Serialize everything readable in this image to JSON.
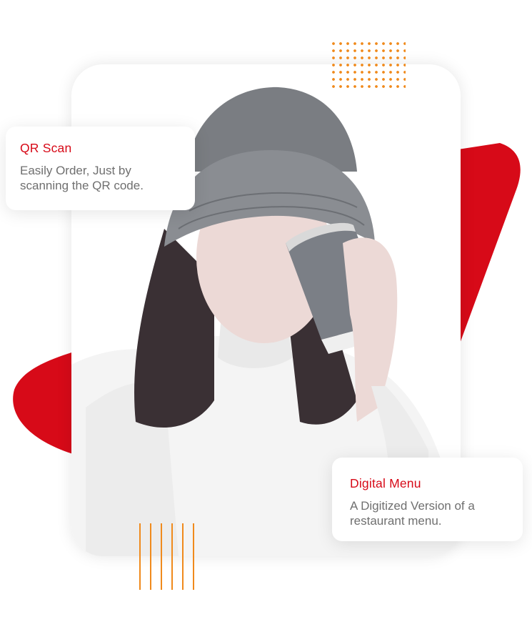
{
  "colors": {
    "brand_red": "#d70a18",
    "accent_orange": "#f08a1c",
    "text_gray": "#6f6f6f",
    "card_bg": "#ffffff"
  },
  "cards": {
    "qr": {
      "title": "QR Scan",
      "description": "Easily Order, Just by scanning the QR code."
    },
    "menu": {
      "title": "Digital Menu",
      "description": "A Digitized Version of a restaurant menu."
    }
  },
  "decor": {
    "dot_grid_icon": "dot-grid-pattern",
    "line_group_icon": "vertical-lines-pattern"
  }
}
